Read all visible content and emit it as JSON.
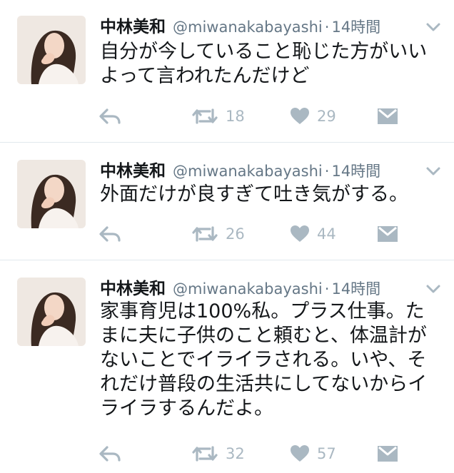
{
  "tweets": [
    {
      "author_name": "中林美和",
      "handle": "@miwanakabayashi",
      "separator": "·",
      "time": "14時間",
      "text": "自分が今していること恥じた方がいい\nよって言われたんだけど",
      "retweet_count": "18",
      "like_count": "29"
    },
    {
      "author_name": "中林美和",
      "handle": "@miwanakabayashi",
      "separator": "·",
      "time": "14時間",
      "text": "外面だけが良すぎて吐き気がする。",
      "retweet_count": "26",
      "like_count": "44"
    },
    {
      "author_name": "中林美和",
      "handle": "@miwanakabayashi",
      "separator": "·",
      "time": "14時間",
      "text": "家事育児は100%私。プラス仕事。た\nまに夫に子供のこと頼むと、体温計が\nないことでイライラされる。いや、そ\nれだけ普段の生活共にしてないからイ\nライラするんだよ。",
      "retweet_count": "32",
      "like_count": "57"
    }
  ],
  "colors": {
    "text": "#14171a",
    "secondary": "#657786",
    "icon": "#aab8c2",
    "divider": "#e1e8ed"
  },
  "icons": {
    "reply": "reply-icon",
    "retweet": "retweet-icon",
    "like": "heart-icon",
    "dm": "direct-message-icon",
    "menu": "chevron-down-icon"
  }
}
